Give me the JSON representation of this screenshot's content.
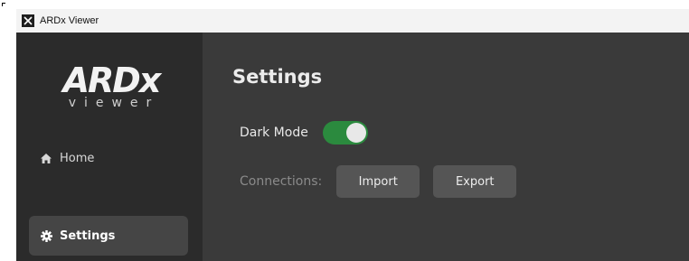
{
  "window": {
    "title": "ARDx Viewer",
    "icon": "close-x-icon"
  },
  "logo": {
    "main": "ARDx",
    "sub": "viewer"
  },
  "sidebar": {
    "items": [
      {
        "label": "Home",
        "icon": "home-icon",
        "active": false
      },
      {
        "label": "Settings",
        "icon": "gear-icon",
        "active": true
      }
    ]
  },
  "main": {
    "title": "Settings",
    "dark_mode": {
      "label": "Dark Mode",
      "enabled": true
    },
    "connections": {
      "label": "Connections:",
      "import_label": "Import",
      "export_label": "Export"
    }
  },
  "colors": {
    "sidebar_bg": "#2b2b2b",
    "main_bg": "#3a3a3a",
    "toggle_on": "#2b8a3e",
    "active_nav_bg": "#454545",
    "button_bg": "#555555"
  }
}
